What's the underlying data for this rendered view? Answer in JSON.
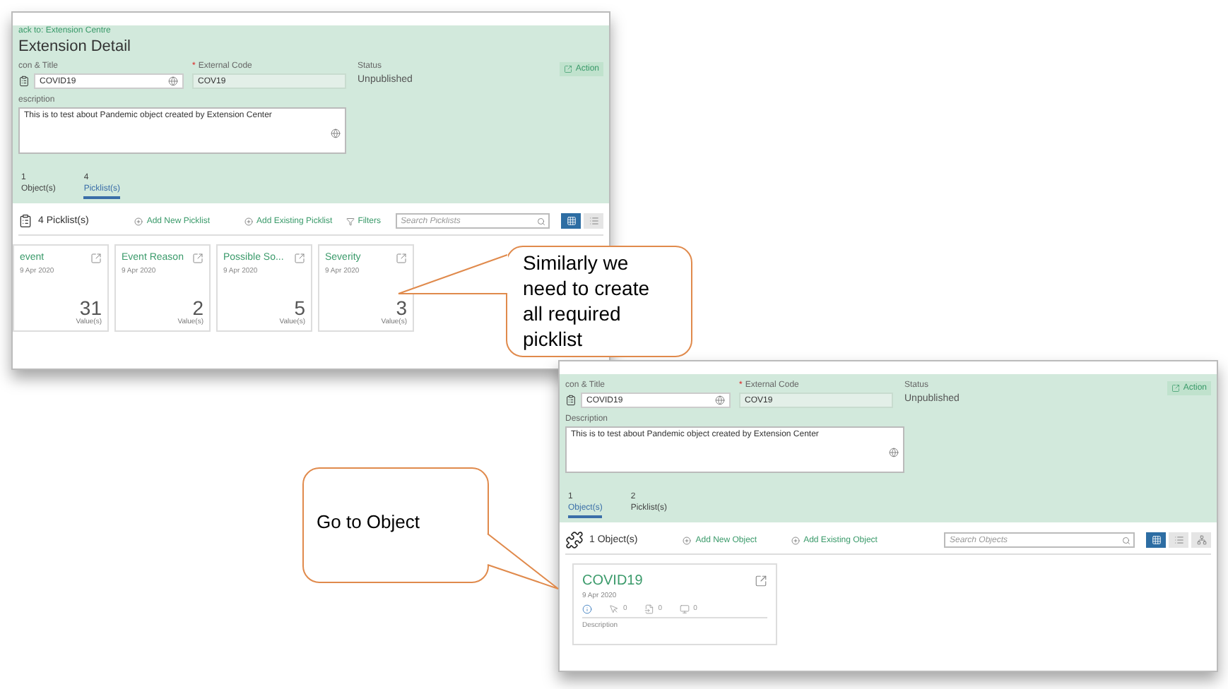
{
  "screenshots": [
    {
      "back_link": "ack to: Extension Centre",
      "title": "Extension Detail",
      "icon_title_label": "con & Title",
      "title_value": "COVID19",
      "required_mark": "*",
      "external_code_label": "External Code",
      "external_code_value": "COV19",
      "status_label": "Status",
      "status_value": "Unpublished",
      "action_button": "Action",
      "description_label": "escription",
      "description_value": "This is to test about Pandemic object created by Extension Center",
      "tabs": [
        {
          "count": "1",
          "label": "Object(s)",
          "selected": false
        },
        {
          "count": "4",
          "label": "Picklist(s)",
          "selected": true
        }
      ],
      "toolbar": {
        "kind": "picklist",
        "count": "4 Picklist(s)",
        "actions": [
          "Add New Picklist",
          "Add Existing Picklist"
        ],
        "filters": "Filters",
        "search_placeholder": "Search Picklists",
        "views": [
          {
            "kind": "grid",
            "selected": true
          },
          {
            "kind": "list",
            "selected": false
          }
        ]
      },
      "cards": [
        {
          "kind": "picklist",
          "title": "event",
          "date": "9 Apr 2020",
          "count": "31",
          "unit": "Value(s)"
        },
        {
          "kind": "picklist",
          "title": "Event Reason",
          "date": "9 Apr 2020",
          "count": "2",
          "unit": "Value(s)"
        },
        {
          "kind": "picklist",
          "title": "Possible So...",
          "date": "9 Apr 2020",
          "count": "5",
          "unit": "Value(s)"
        },
        {
          "kind": "picklist",
          "title": "Severity",
          "date": "9 Apr 2020",
          "count": "3",
          "unit": "Value(s)"
        }
      ]
    },
    {
      "icon_title_label": "con & Title",
      "title_value": "COVID19",
      "required_mark": "*",
      "external_code_label": "External Code",
      "external_code_value": "COV19",
      "status_label": "Status",
      "status_value": "Unpublished",
      "action_button": "Action",
      "description_label": "Description",
      "description_value": "This is to test about Pandemic object created by Extension Center",
      "tabs": [
        {
          "count": "1",
          "label": "Object(s)",
          "selected": true
        },
        {
          "count": "2",
          "label": "Picklist(s)",
          "selected": false
        }
      ],
      "toolbar": {
        "kind": "object",
        "count": "1 Object(s)",
        "actions": [
          "Add New Object",
          "Add Existing Object"
        ],
        "search_placeholder": "Search Objects",
        "views": [
          {
            "kind": "grid",
            "selected": true
          },
          {
            "kind": "list",
            "selected": false
          },
          {
            "kind": "hierarchy",
            "selected": false
          }
        ]
      },
      "cards": [
        {
          "kind": "object",
          "title": "COVID19",
          "date": "9 Apr 2020",
          "stats": [
            {
              "kind": "info"
            },
            {
              "kind": "pointer",
              "value": "0"
            },
            {
              "kind": "form",
              "value": "0"
            },
            {
              "kind": "screen",
              "value": "0"
            }
          ],
          "description_label": "Description"
        }
      ]
    }
  ],
  "callouts": [
    "Similarly we need to create all required picklist",
    "Go to Object"
  ]
}
